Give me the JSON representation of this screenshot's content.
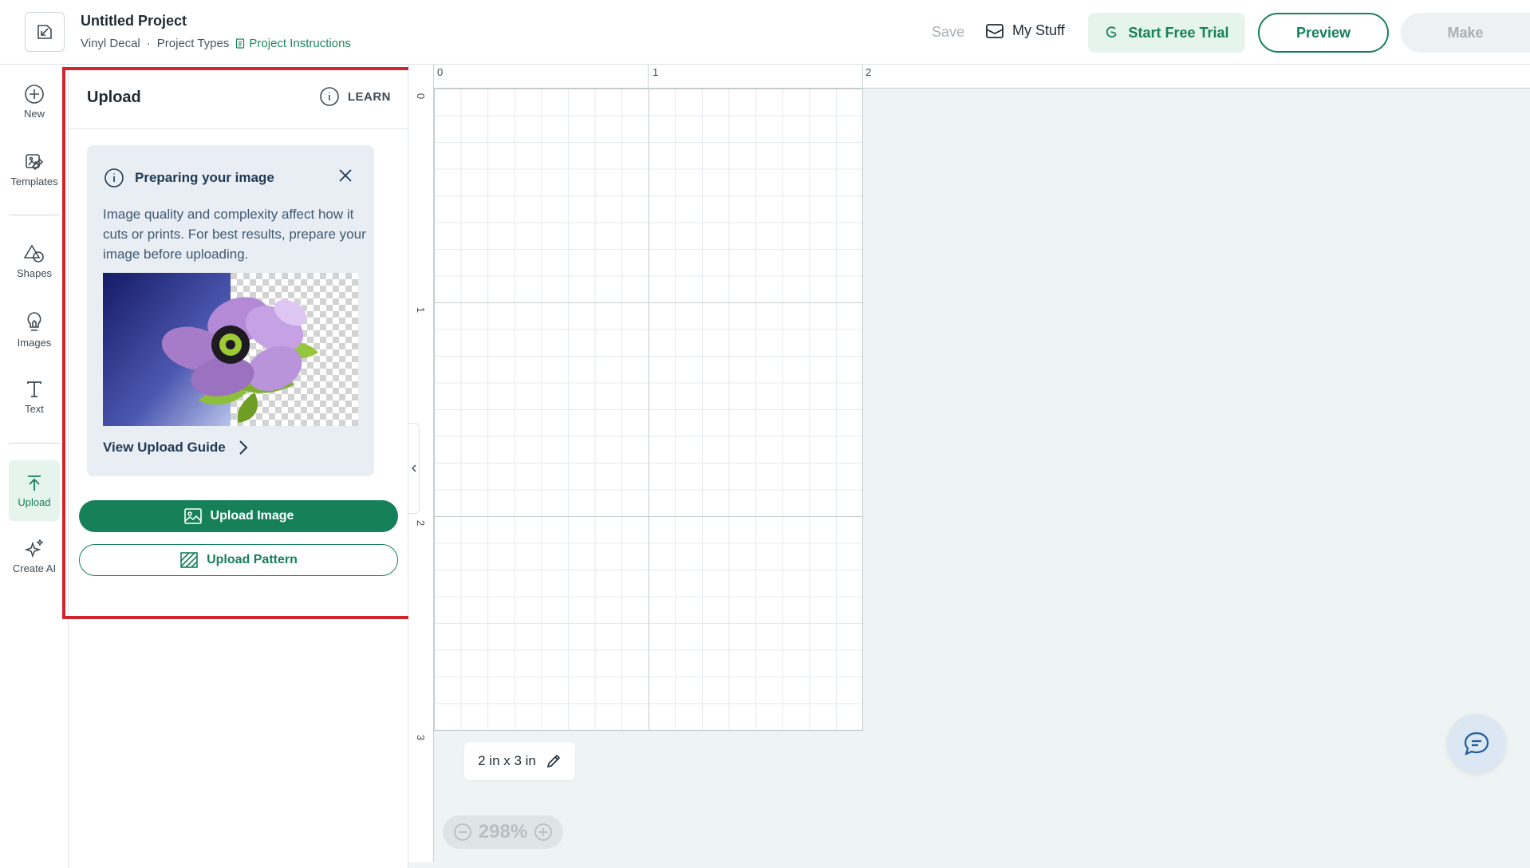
{
  "header": {
    "project_title": "Untitled Project",
    "project_type": "Vinyl Decal",
    "separator": "·",
    "project_types_label": "Project Types",
    "project_instructions_label": "Project Instructions",
    "save_label": "Save",
    "my_stuff_label": "My Stuff",
    "start_trial_label": "Start Free Trial",
    "preview_label": "Preview",
    "make_label": "Make"
  },
  "rail": {
    "items": [
      {
        "label": "New",
        "icon": "plus-circle-icon"
      },
      {
        "label": "Templates",
        "icon": "templates-icon"
      },
      {
        "label": "Shapes",
        "icon": "shapes-icon"
      },
      {
        "label": "Images",
        "icon": "lightbulb-icon"
      },
      {
        "label": "Text",
        "icon": "text-icon"
      },
      {
        "label": "Upload",
        "icon": "upload-icon",
        "active": true
      },
      {
        "label": "Create AI",
        "icon": "sparkle-icon"
      }
    ]
  },
  "panel": {
    "title": "Upload",
    "learn_label": "LEARN",
    "info_card": {
      "title": "Preparing your image",
      "body": "Image quality and complexity affect how it cuts or prints. For best results, prepare your image before uploading.",
      "guide_link": "View Upload Guide"
    },
    "upload_image_label": "Upload Image",
    "upload_pattern_label": "Upload Pattern"
  },
  "canvas": {
    "ruler_top": [
      "0",
      "1",
      "2"
    ],
    "ruler_left": [
      "0",
      "1",
      "2",
      "3"
    ],
    "size_label": "2 in x 3 in",
    "zoom_level": "298%"
  },
  "colors": {
    "brand_green": "#16805a",
    "highlight_red": "#d4242b",
    "info_card_bg": "#e8eef3"
  }
}
